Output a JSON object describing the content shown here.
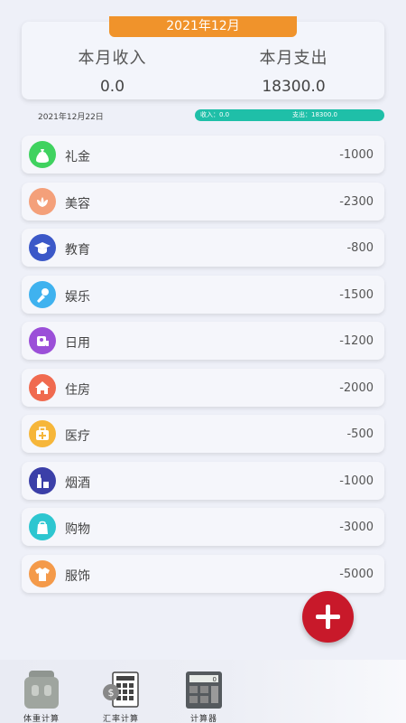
{
  "header": {
    "month": "2021年12月",
    "income_label": "本月收入",
    "income_value": "0.0",
    "expense_label": "本月支出",
    "expense_value": "18300.0"
  },
  "day": {
    "date": "2021年12月22日",
    "income_text": "收入：0.0",
    "expense_text": "支出：18300.0"
  },
  "records": [
    {
      "name": "礼金",
      "amount": "-1000",
      "icon": "money-bag-icon",
      "color": "#3fd25f"
    },
    {
      "name": "美容",
      "amount": "-2300",
      "icon": "lotus-icon",
      "color": "#f4a07a"
    },
    {
      "name": "教育",
      "amount": "-800",
      "icon": "graduation-cap-icon",
      "color": "#3b58c8"
    },
    {
      "name": "娱乐",
      "amount": "-1500",
      "icon": "microphone-icon",
      "color": "#3fb2ef"
    },
    {
      "name": "日用",
      "amount": "-1200",
      "icon": "toilet-paper-icon",
      "color": "#9b4fd8"
    },
    {
      "name": "住房",
      "amount": "-2000",
      "icon": "house-icon",
      "color": "#f06a4f"
    },
    {
      "name": "医疗",
      "amount": "-500",
      "icon": "medical-kit-icon",
      "color": "#f6b63a"
    },
    {
      "name": "烟酒",
      "amount": "-1000",
      "icon": "bottle-icon",
      "color": "#3b3fa8"
    },
    {
      "name": "购物",
      "amount": "-3000",
      "icon": "shopping-bag-icon",
      "color": "#2dc6d0"
    },
    {
      "name": "服饰",
      "amount": "-5000",
      "icon": "shirt-icon",
      "color": "#f49a4a"
    }
  ],
  "toolbar": {
    "bmi_label": "体重计算",
    "rate_label": "汇率计算",
    "calc_label": "计算器"
  },
  "colors": {
    "accent_orange": "#f0932b",
    "fab_red": "#c8192a",
    "bar_teal": "#1fbfa8"
  }
}
